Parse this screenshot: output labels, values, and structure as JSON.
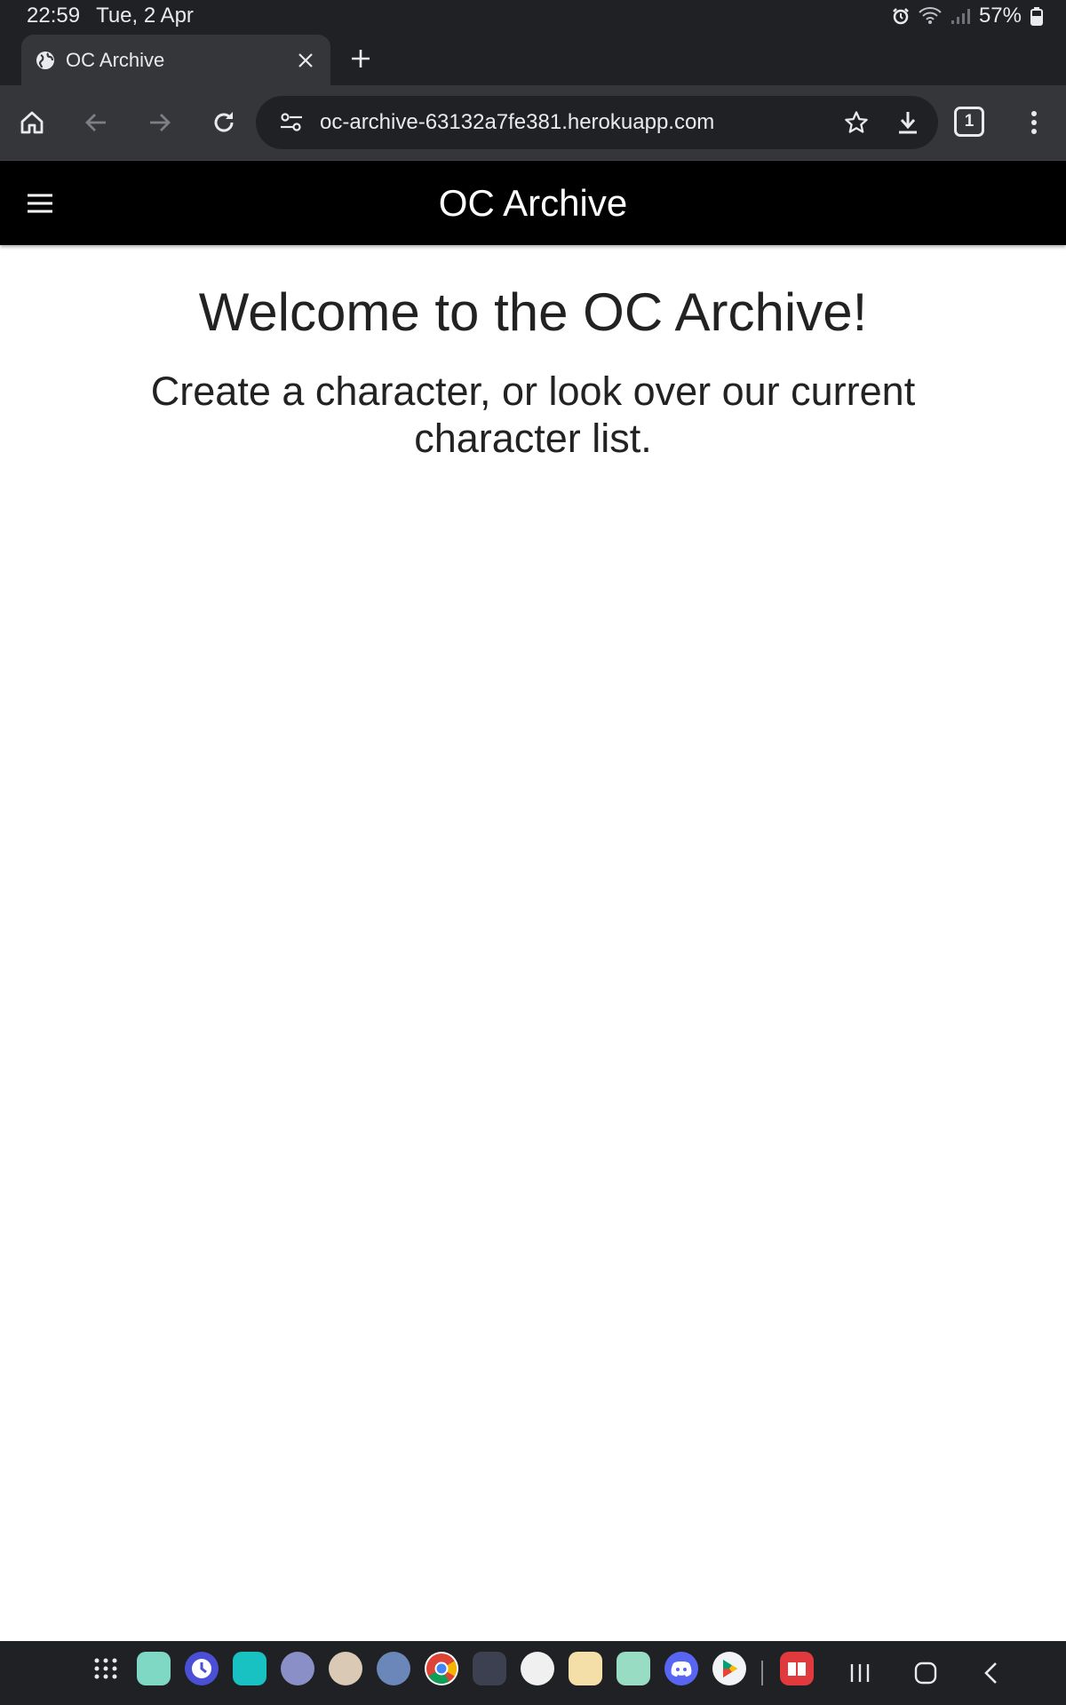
{
  "status_bar": {
    "time": "22:59",
    "date": "Tue, 2 Apr",
    "battery": "57%",
    "icons": [
      "alarm-icon",
      "wifi-icon",
      "signal-icon",
      "battery-icon"
    ]
  },
  "browser": {
    "tab": {
      "title": "OC Archive",
      "favicon": "globe-icon"
    },
    "url": "oc-archive-63132a7fe381.herokuapp.com",
    "tab_count": "1",
    "icons": [
      "home-icon",
      "back-icon",
      "forward-icon",
      "reload-icon",
      "site-settings-icon",
      "bookmark-star-icon",
      "download-icon",
      "more-menu-icon"
    ]
  },
  "site": {
    "brand": "OC Archive",
    "menu_icon": "hamburger-icon",
    "heading": "Welcome to the OC Archive!",
    "subheading": "Create a character, or look over our current character list."
  },
  "colors": {
    "browser_chrome": "#202124",
    "toolbar": "#35363a",
    "site_nav": "#000000",
    "page_bg": "#ffffff",
    "text": "#222222"
  },
  "dock": {
    "apps": [
      "app-drawer-icon",
      "app-folder-icon",
      "clock-app-icon",
      "app-folder-icon",
      "game-app-icon",
      "game-app-icon",
      "game-app-icon",
      "chrome-app-icon",
      "app-folder-icon",
      "app-icon",
      "app-folder-icon",
      "app-folder-icon",
      "discord-app-icon",
      "play-store-app-icon",
      "reader-app-icon"
    ],
    "system": [
      "recents-icon",
      "home-circle-icon",
      "system-back-icon"
    ]
  }
}
